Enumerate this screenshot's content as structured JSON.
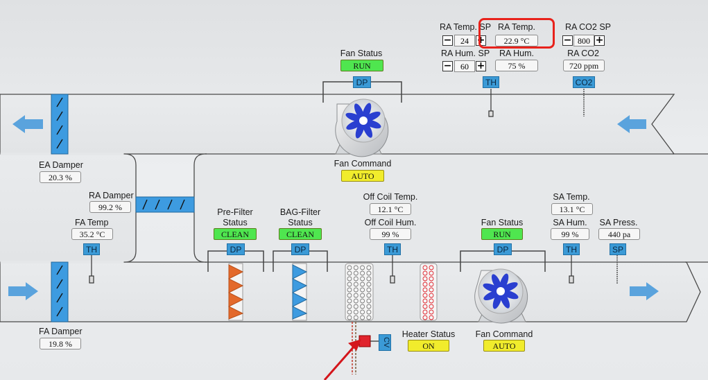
{
  "colors": {
    "highlight": "#e8221b",
    "status_ok": "#4fe64f",
    "status_mode": "#f1ec2c",
    "tag": "#3b9ad6"
  },
  "return_air": {
    "temp_sp_label": "RA Temp. SP",
    "temp_sp_value": "24",
    "temp_label": "RA Temp.",
    "temp_value": "22.9 °C",
    "co2_sp_label": "RA CO2 SP",
    "co2_sp_value": "800",
    "hum_sp_label": "RA Hum. SP",
    "hum_sp_value": "60",
    "hum_label": "RA Hum.",
    "hum_value": "75 %",
    "co2_label": "RA CO2",
    "co2_value": "720 ppm",
    "th_tag": "TH",
    "co2_tag": "CO2",
    "minus": "−",
    "plus": "+"
  },
  "return_fan": {
    "status_label": "Fan Status",
    "status_value": "RUN",
    "dp_tag": "DP",
    "command_label": "Fan Command",
    "command_value": "AUTO"
  },
  "dampers": {
    "ea_label": "EA Damper",
    "ea_value": "20.3 %",
    "ra_label": "RA Damper",
    "ra_value": "99.2 %",
    "fa_label": "FA Damper",
    "fa_value": "19.8 %"
  },
  "fresh_air": {
    "temp_label": "FA Temp",
    "temp_value": "35.2 °C",
    "th_tag": "TH"
  },
  "pre_filter": {
    "label_line1": "Pre-Filter",
    "label_line2": "Status",
    "status": "CLEAN",
    "dp_tag": "DP"
  },
  "bag_filter": {
    "label_line1": "BAG-Filter",
    "label_line2": "Status",
    "status": "CLEAN",
    "dp_tag": "DP"
  },
  "coil": {
    "temp_label": "Off Coil Temp.",
    "temp_value": "12.1 °C",
    "hum_label": "Off Coil Hum.",
    "hum_value": "99 %",
    "th_tag": "TH",
    "cv_tag": "CV"
  },
  "heater": {
    "status_label": "Heater Status",
    "status_value": "ON"
  },
  "supply_fan": {
    "status_label": "Fan Status",
    "status_value": "RUN",
    "dp_tag": "DP",
    "command_label": "Fan Command",
    "command_value": "AUTO"
  },
  "supply_air": {
    "temp_label": "SA Temp.",
    "temp_value": "13.1 °C",
    "hum_label": "SA Hum.",
    "hum_value": "99 %",
    "press_label": "SA Press.",
    "press_value": "440 pa",
    "th_tag": "TH",
    "sp_tag": "SP"
  }
}
